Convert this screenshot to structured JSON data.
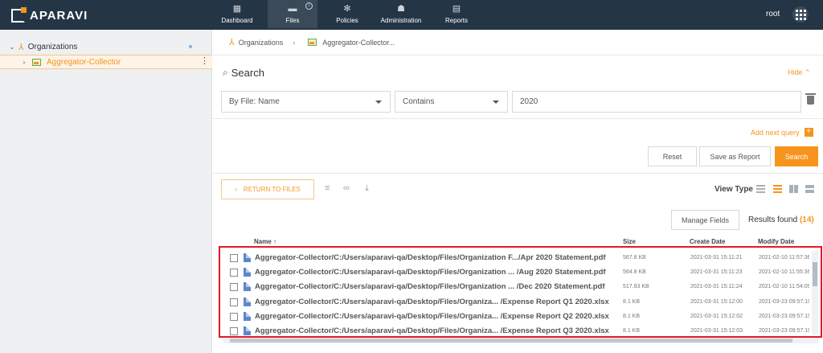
{
  "brand": {
    "name": "APARAVI",
    "accent": "#f7941d",
    "nav_bg": "#243545"
  },
  "nav": {
    "tabs": [
      {
        "label": "Dashboard",
        "icon": "dashboard-icon"
      },
      {
        "label": "Files",
        "icon": "folder-icon",
        "active": true
      },
      {
        "label": "Policies",
        "icon": "gear-icon"
      },
      {
        "label": "Administration",
        "icon": "users-icon"
      },
      {
        "label": "Reports",
        "icon": "clipboard-icon"
      }
    ],
    "user": "root"
  },
  "sidebar": {
    "items": [
      {
        "label": "Organizations",
        "icon": "organization-icon"
      },
      {
        "label": "Aggregator-Collector",
        "icon": "collector-icon",
        "selected": true
      }
    ]
  },
  "breadcrumb": {
    "items": [
      "Organizations",
      "Aggregator-Collector..."
    ]
  },
  "search": {
    "title": "Search",
    "hide_label": "Hide",
    "field_select": "By File: Name",
    "operator_select": "Contains",
    "value": "2020",
    "add_query_label": "Add next query",
    "reset_label": "Reset",
    "save_report_label": "Save as Report",
    "search_label": "Search"
  },
  "toolbar": {
    "return_label": "RETURN TO FILES",
    "view_type_label": "View Type",
    "manage_fields_label": "Manage Fields",
    "results_label": "Results found",
    "results_count": "(14)"
  },
  "table": {
    "columns": [
      "Name",
      "Size",
      "Create Date",
      "Modify Date"
    ],
    "rows": [
      {
        "name": "Aggregator-Collector/C:/Users/aparavi-qa/Desktop/Files/Organization F.../Apr 2020 Statement.pdf",
        "size": "567.8 KB",
        "create": "2021-03-31 15:11:21",
        "modify": "2021-02-10 11:57:36"
      },
      {
        "name": "Aggregator-Collector/C:/Users/aparavi-qa/Desktop/Files/Organization ... /Aug 2020 Statement.pdf",
        "size": "564.8 KB",
        "create": "2021-03-31 15:11:23",
        "modify": "2021-02-10 11:55:36"
      },
      {
        "name": "Aggregator-Collector/C:/Users/aparavi-qa/Desktop/Files/Organization ... /Dec 2020 Statement.pdf",
        "size": "517.83 KB",
        "create": "2021-03-31 15:11:24",
        "modify": "2021-02-10 11:54:09"
      },
      {
        "name": "Aggregator-Collector/C:/Users/aparavi-qa/Desktop/Files/Organiza... /Expense Report Q1 2020.xlsx",
        "size": "8.1 KB",
        "create": "2021-03-31 15:12:00",
        "modify": "2021-03-23 09:57:19"
      },
      {
        "name": "Aggregator-Collector/C:/Users/aparavi-qa/Desktop/Files/Organiza... /Expense Report Q2 2020.xlsx",
        "size": "8.1 KB",
        "create": "2021-03-31 15:12:02",
        "modify": "2021-03-23 09:57:19"
      },
      {
        "name": "Aggregator-Collector/C:/Users/aparavi-qa/Desktop/Files/Organiza... /Expense Report Q3 2020.xlsx",
        "size": "8.1 KB",
        "create": "2021-03-31 15:12:03",
        "modify": "2021-03-23 09:57:19"
      }
    ]
  }
}
